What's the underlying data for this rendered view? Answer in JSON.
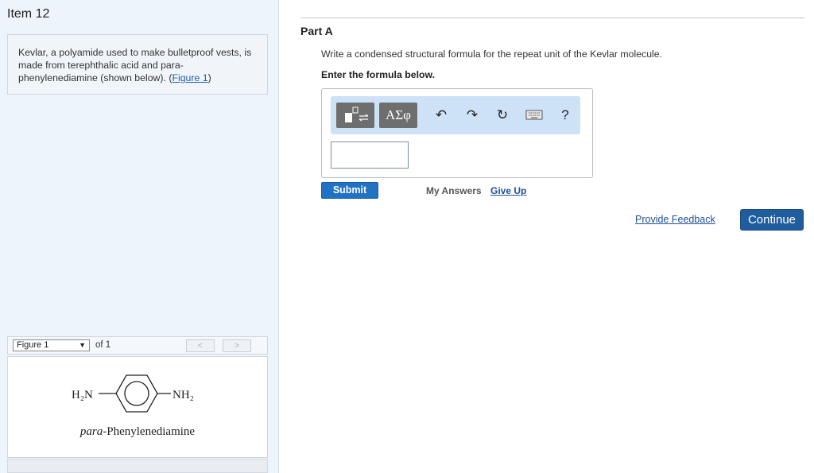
{
  "sidebar": {
    "item_title": "Item 12",
    "problem_text": "Kevlar, a polyamide used to make bulletproof vests, is made from terephthalic acid and para-phenylenediamine (shown below). (",
    "figure_link": "Figure 1",
    "problem_text_end": ")",
    "figure_nav": {
      "selected": "Figure 1",
      "of_text": "of 1",
      "prev": "<",
      "next": ">"
    },
    "figure": {
      "left_group": "H₂N",
      "right_group": "NH₂",
      "caption_italic": "para",
      "caption_rest": "-Phenylenediamine"
    }
  },
  "main": {
    "part_title": "Part A",
    "prompt": "Write a condensed structural formula for the repeat unit of the Kevlar molecule.",
    "enter_label": "Enter the formula below.",
    "toolbar": {
      "greek_label": "ΑΣφ",
      "undo_icon": "undo-icon",
      "redo_icon": "redo-icon",
      "reset_icon": "reset-icon",
      "keyboard_icon": "keyboard-icon",
      "help_label": "?"
    },
    "answer_value": "",
    "submit_label": "Submit",
    "my_answers_label": "My Answers",
    "give_up_label": "Give Up"
  },
  "footer": {
    "feedback_label": "Provide Feedback",
    "continue_label": "Continue"
  }
}
